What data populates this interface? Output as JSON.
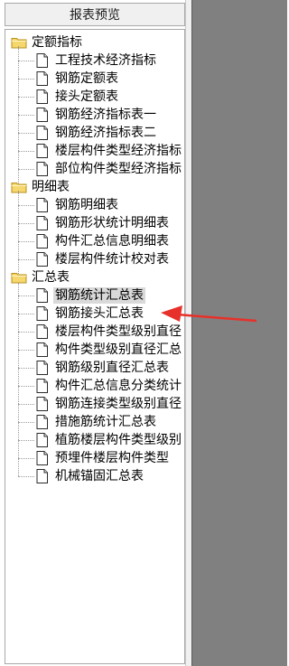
{
  "panel": {
    "title": "报表预览"
  },
  "groups": [
    {
      "label": "定额指标",
      "items": [
        "工程技术经济指标",
        "钢筋定额表",
        "接头定额表",
        "钢筋经济指标表一",
        "钢筋经济指标表二",
        "楼层构件类型经济指标",
        "部位构件类型经济指标"
      ]
    },
    {
      "label": "明细表",
      "items": [
        "钢筋明细表",
        "钢筋形状统计明细表",
        "构件汇总信息明细表",
        "楼层构件统计校对表"
      ]
    },
    {
      "label": "汇总表",
      "items": [
        "钢筋统计汇总表",
        "钢筋接头汇总表",
        "楼层构件类型级别直径",
        "构件类型级别直径汇总",
        "钢筋级别直径汇总表",
        "构件汇总信息分类统计",
        "钢筋连接类型级别直径",
        "措施筋统计汇总表",
        "植筋楼层构件类型级别",
        "预埋件楼层构件类型",
        "机械锚固汇总表"
      ]
    }
  ],
  "selected_item": "钢筋统计汇总表",
  "annotation": {
    "color": "#e8302a",
    "points_to": "钢筋接头汇总表"
  },
  "colors": {
    "folder": "#f5d76e",
    "folder_border": "#b8901c",
    "preview_bg": "#808080",
    "selection": "#d9d9d9"
  },
  "icons": {
    "folder": "folder-icon",
    "document": "document-icon"
  }
}
